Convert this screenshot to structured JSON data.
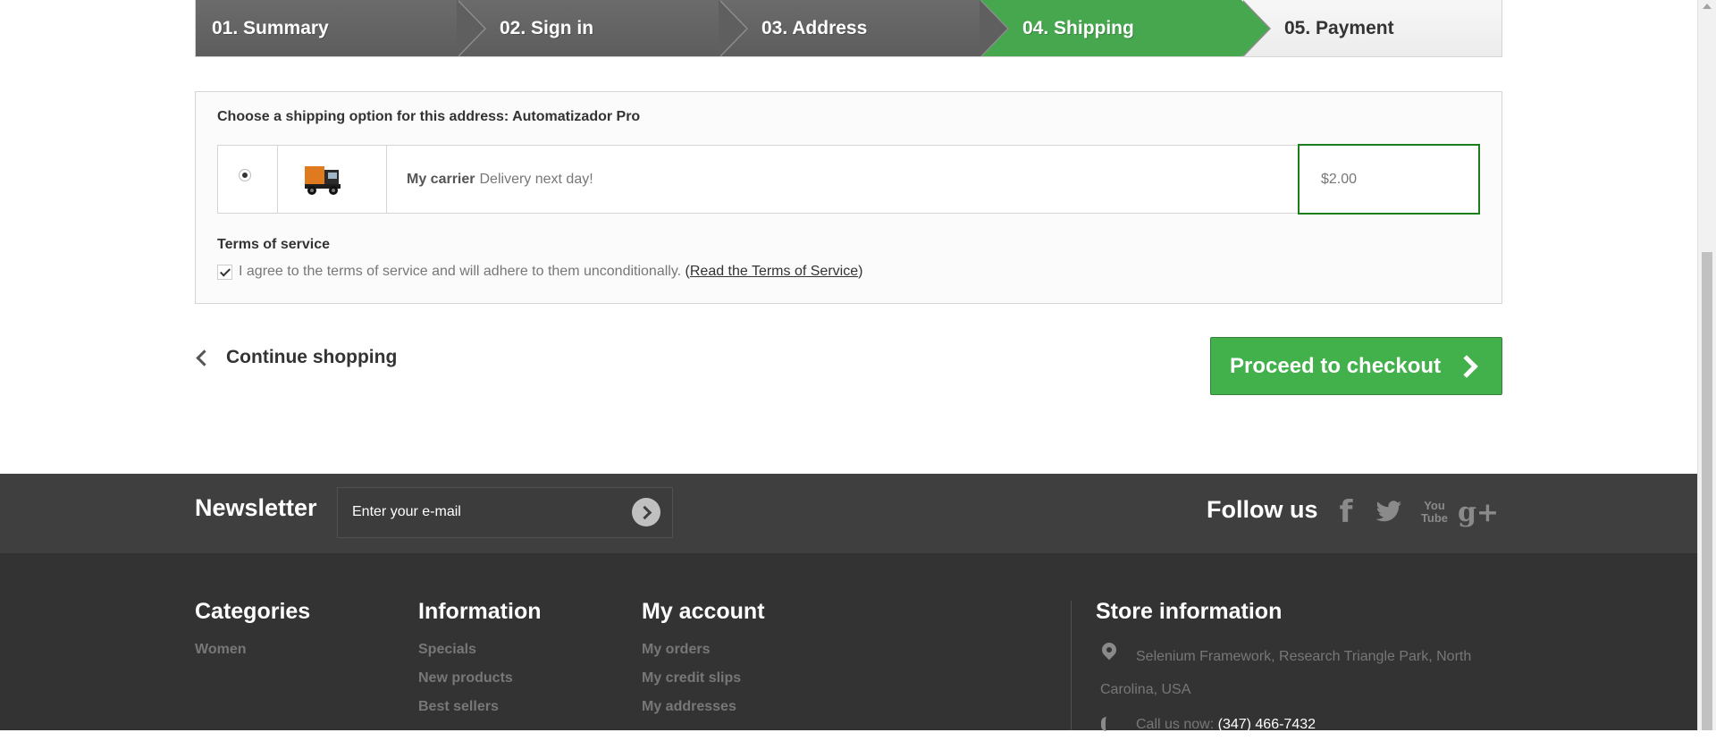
{
  "steps": [
    {
      "label": "01. Summary"
    },
    {
      "label": "02. Sign in"
    },
    {
      "label": "03. Address"
    },
    {
      "label": "04. Shipping"
    },
    {
      "label": "05. Payment"
    }
  ],
  "shipping": {
    "title": "Choose a shipping option for this address: Automatizador Pro",
    "carrier_name": "My carrier",
    "carrier_delay": "Delivery next day!",
    "price": "$2.00",
    "carrier_icon": "truck-icon"
  },
  "terms": {
    "title": "Terms of service",
    "agree_text": "I agree to the terms of service and will adhere to them unconditionally.",
    "open_paren": "(",
    "link_text": "Read the Terms of Service",
    "close_paren": ")"
  },
  "nav": {
    "continue_label": "Continue shopping",
    "checkout_label": "Proceed to checkout"
  },
  "footer": {
    "newsletter_label": "Newsletter",
    "newsletter_placeholder": "Enter your e-mail",
    "follow_label": "Follow us",
    "social": {
      "facebook": "f",
      "youtube_line1": "You",
      "youtube_line2": "Tube",
      "gplus": "g+"
    },
    "categories": {
      "title": "Categories",
      "links": [
        "Women"
      ]
    },
    "information": {
      "title": "Information",
      "links": [
        "Specials",
        "New products",
        "Best sellers"
      ]
    },
    "account": {
      "title": "My account",
      "links": [
        "My orders",
        "My credit slips",
        "My addresses"
      ]
    },
    "store": {
      "title": "Store information",
      "address_line1": "Selenium Framework, Research Triangle Park, North",
      "address_line2": "Carolina, USA",
      "call_label": "Call us now:",
      "phone": "(347) 466-7432"
    }
  },
  "colors": {
    "accent": "#46a74e",
    "checkout": "#43b14b",
    "footer": "#333333"
  }
}
